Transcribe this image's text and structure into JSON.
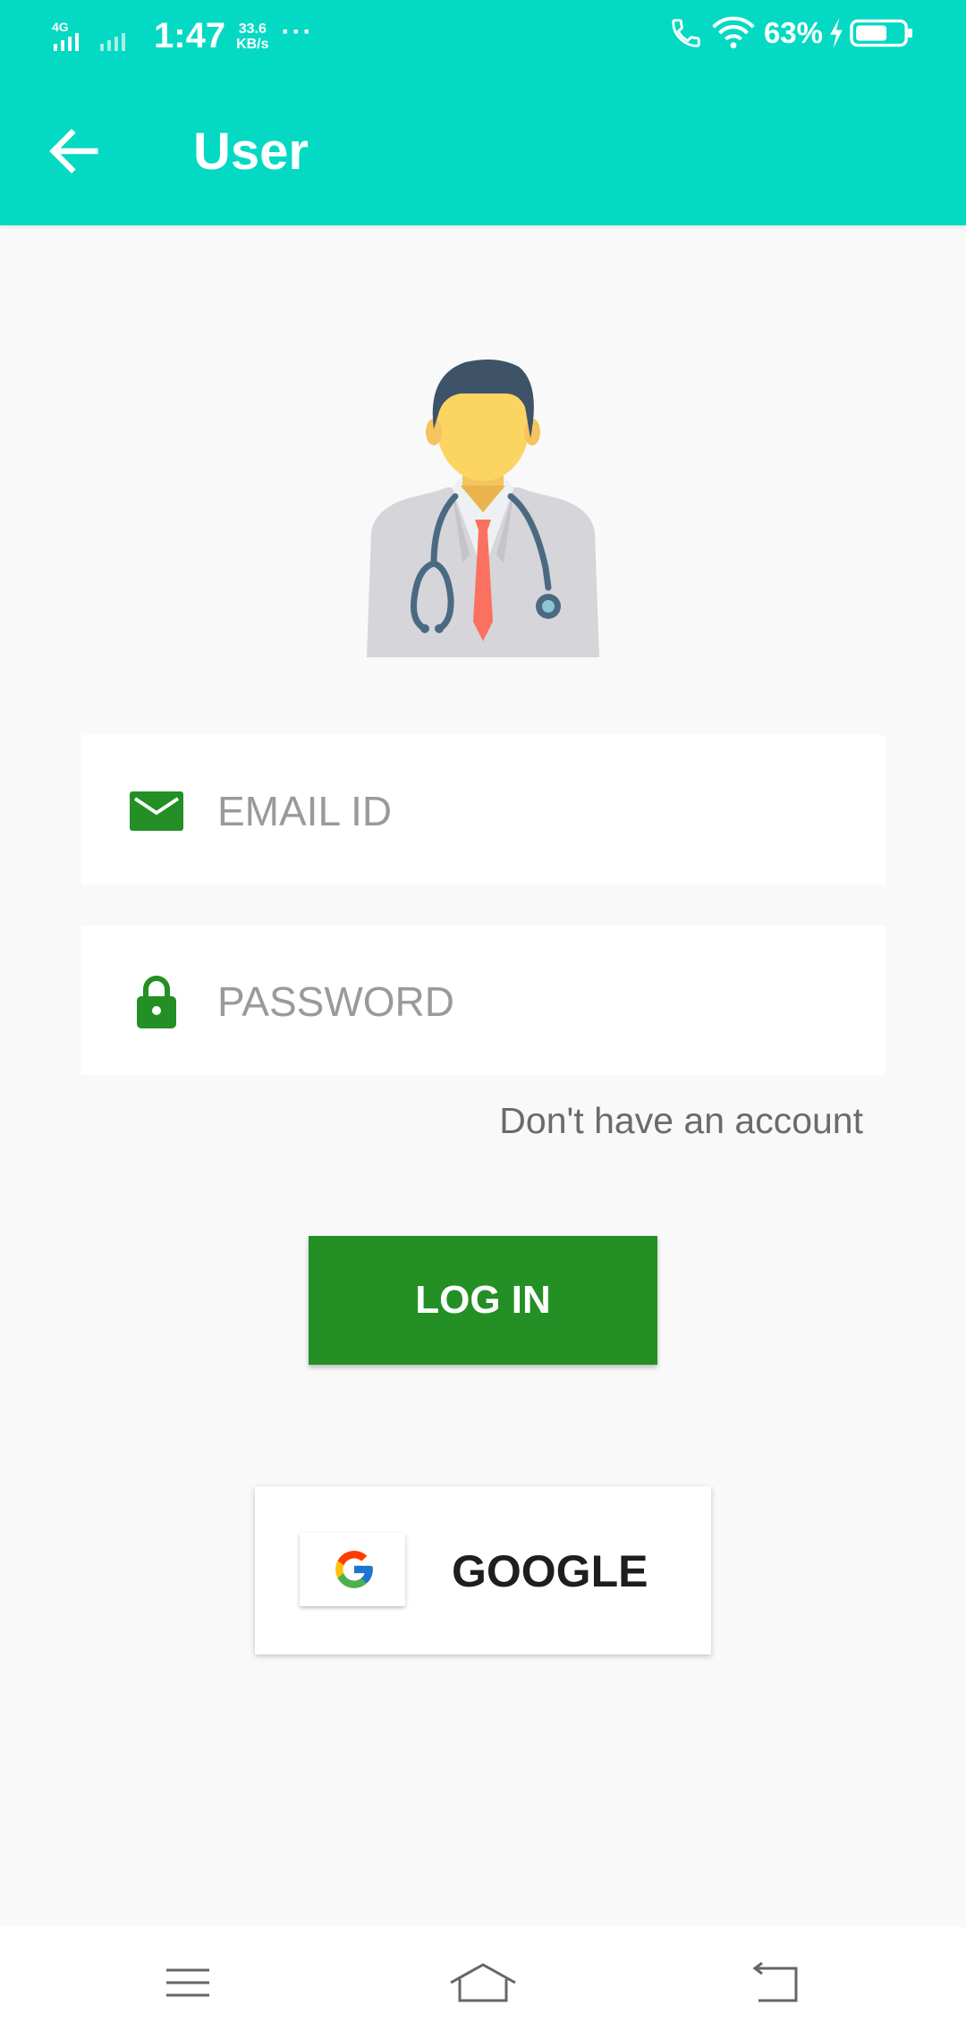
{
  "status_bar": {
    "network": "4G",
    "time": "1:47",
    "speed_value": "33.6",
    "speed_unit": "KB/s",
    "more": "···",
    "battery": "63%",
    "icons": [
      "signal-icon",
      "call-icon",
      "wifi-icon",
      "charging-icon",
      "battery-icon"
    ]
  },
  "app_bar": {
    "title": "User",
    "back_icon": "back-arrow-icon",
    "background": "#04d9c4"
  },
  "avatar_icon": "doctor-avatar-icon",
  "form": {
    "email": {
      "placeholder": "EMAIL ID",
      "value": "",
      "icon": "mail-icon"
    },
    "password": {
      "placeholder": "PASSWORD",
      "value": "",
      "icon": "lock-icon"
    },
    "signup_link": "Don't have an account",
    "login_label": "LOG IN",
    "google_label": "GOOGLE",
    "accent_color": "#248f24"
  },
  "nav_bar": {
    "items": [
      "menu-icon",
      "home-icon",
      "back-icon"
    ]
  }
}
